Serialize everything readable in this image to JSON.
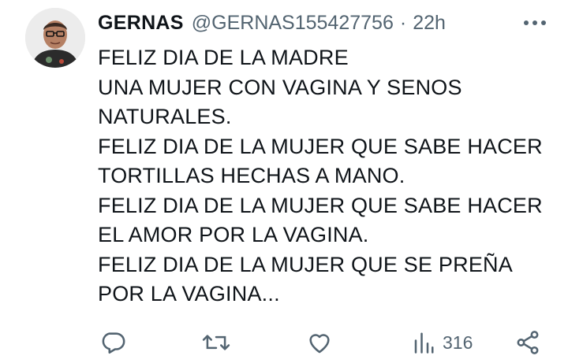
{
  "tweet": {
    "author": {
      "name": "GERNAS",
      "handle": "@GERNAS155427756"
    },
    "separator": "·",
    "time": "22h",
    "text_lines": [
      "FELIZ DIA DE LA MADRE",
      "UNA MUJER CON VAGINA Y SENOS",
      "NATURALES.",
      "FELIZ DIA DE LA MUJER QUE SABE HACER",
      "TORTILLAS HECHAS A MANO.",
      "FELIZ DIA DE LA MUJER QUE SABE HACER",
      "EL AMOR POR LA VAGINA.",
      "FELIZ DIA DE LA MUJER QUE SE PREÑA",
      "POR LA VAGINA..."
    ],
    "actions": {
      "reply_icon": "reply-icon",
      "retweet_icon": "retweet-icon",
      "like_icon": "heart-icon",
      "views_icon": "views-icon",
      "views_count": "316",
      "share_icon": "share-icon"
    }
  },
  "colors": {
    "text": "#0f1419",
    "secondary": "#536471",
    "background": "#ffffff"
  }
}
